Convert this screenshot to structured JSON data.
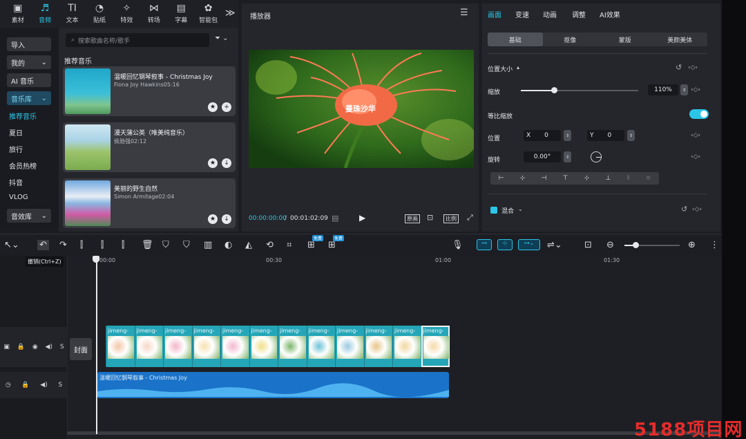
{
  "toolbar": {
    "tools": [
      {
        "label": "素材",
        "icon": "media-icon",
        "glyph": "▣"
      },
      {
        "label": "音频",
        "icon": "audio-icon",
        "glyph": "♬"
      },
      {
        "label": "文本",
        "icon": "text-icon",
        "glyph": "TI"
      },
      {
        "label": "贴纸",
        "icon": "sticker-icon",
        "glyph": "◔"
      },
      {
        "label": "特效",
        "icon": "effects-icon",
        "glyph": "✧"
      },
      {
        "label": "转场",
        "icon": "transition-icon",
        "glyph": "⋈"
      },
      {
        "label": "字幕",
        "icon": "subtitle-icon",
        "glyph": "▤"
      },
      {
        "label": "智能包",
        "icon": "smart-pack-icon",
        "glyph": "✿"
      }
    ],
    "active_index": 1,
    "more_glyph": "≫"
  },
  "leftnav": {
    "import": "导入",
    "mine": "我的",
    "ai_music": "AI 音乐",
    "music_library": "音乐库",
    "items": [
      "推荐音乐",
      "夏日",
      "旅行",
      "会员热榜",
      "抖音",
      "VLOG"
    ],
    "sound_library": "音效库"
  },
  "library": {
    "search_placeholder": "搜索歌曲名称/歌手",
    "section_title": "推荐音乐",
    "tracks": [
      {
        "title": "温暖回忆钢琴叙事 - Christmas Joy",
        "meta": "Fiona Joy Hawkins05:16",
        "action_icon": "add-icon",
        "action_glyph": "+"
      },
      {
        "title": "漫天蒲公英（唯美纯音乐）",
        "meta": "侯勋强02:12",
        "action_icon": "download-icon",
        "action_glyph": "↓"
      },
      {
        "title": "美丽的野生自然",
        "meta": "Simon Armitage02:04",
        "action_icon": "download-icon",
        "action_glyph": "↓"
      }
    ]
  },
  "player": {
    "title": "播放器",
    "overlay_text": "曼珠沙华",
    "current_time": "00:00:00:00",
    "total_time": "00:01:02:09",
    "separator": "/",
    "original_label": "原画",
    "ratio_label": "比例"
  },
  "props": {
    "tabs": [
      "画面",
      "变速",
      "动画",
      "调整",
      "AI效果"
    ],
    "active_tab": 0,
    "subtabs": [
      "基础",
      "抠像",
      "蒙版",
      "美颜美体"
    ],
    "active_subtab": 0,
    "section_size": "位置大小",
    "scale_label": "缩放",
    "scale_value": "110%",
    "scale_level": 0.28,
    "uniform_scale_label": "等比缩放",
    "uniform_scale_on": true,
    "position_label": "位置",
    "x_label": "X",
    "x_value": "0",
    "y_label": "Y",
    "y_value": "0",
    "rotate_label": "旋转",
    "rotate_value": "0.00°",
    "blend_label": "混合"
  },
  "edit_toolbar": {
    "tooltip": "撤销(Ctrl+Z)",
    "badges": [
      "免费",
      "免费"
    ]
  },
  "timeline": {
    "ruler": [
      "00:00",
      "00:30",
      "01:00",
      "01:30"
    ],
    "cover_label": "封面",
    "clip_label": "jimeng-",
    "clip_count": 12,
    "audio_label": "温暖回忆钢琴叙事 - Christmas Joy"
  },
  "watermark": "5188项目网",
  "colors": {
    "accent": "#2bc6e8",
    "video_track": "#25a6b8",
    "audio_track": "#1a73c8"
  }
}
